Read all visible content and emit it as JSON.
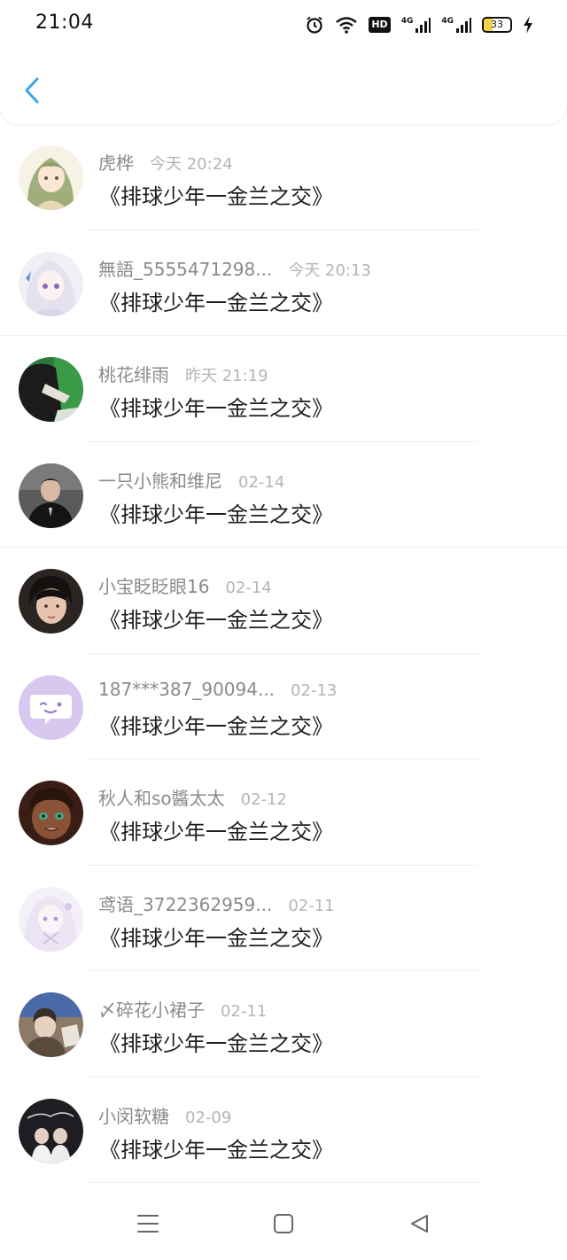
{
  "status_bar": {
    "time": "21:04",
    "hd_label": "HD",
    "network_1": "4G",
    "network_2": "4G",
    "battery_level": "33",
    "battery_fraction": 0.33,
    "icons": [
      "alarm-icon",
      "wifi-icon",
      "hd-icon",
      "signal-icon",
      "signal-icon",
      "battery-icon",
      "charging-icon"
    ]
  },
  "header": {
    "back_icon": "chevron-left-icon",
    "accent_color": "#3da4e6"
  },
  "comments": [
    {
      "user": "虎桦",
      "time": "今天 20:24",
      "text": "《排球少年一金兰之交》"
    },
    {
      "user": "無語_5555471298...",
      "time": "今天 20:13",
      "text": "《排球少年一金兰之交》"
    },
    {
      "user": "桃花绯雨",
      "time": "昨天 21:19",
      "text": "《排球少年一金兰之交》"
    },
    {
      "user": "一只小熊和维尼",
      "time": "02-14",
      "text": "《排球少年一金兰之交》"
    },
    {
      "user": "小宝眨眨眼16",
      "time": "02-14",
      "text": "《排球少年一金兰之交》"
    },
    {
      "user": "187***387_90094...",
      "time": "02-13",
      "text": "《排球少年一金兰之交》"
    },
    {
      "user": "秋人和so醬太太",
      "time": "02-12",
      "text": "《排球少年一金兰之交》"
    },
    {
      "user": "鸢语_3722362959...",
      "time": "02-11",
      "text": "《排球少年一金兰之交》"
    },
    {
      "user": "〆碎花小裙子",
      "time": "02-11",
      "text": "《排球少年一金兰之交》"
    },
    {
      "user": "小闵软糖",
      "time": "02-09",
      "text": "《排球少年一金兰之交》"
    }
  ],
  "nav_bar": {
    "icons": [
      "menu-icon",
      "home-square-icon",
      "back-triangle-icon"
    ]
  }
}
